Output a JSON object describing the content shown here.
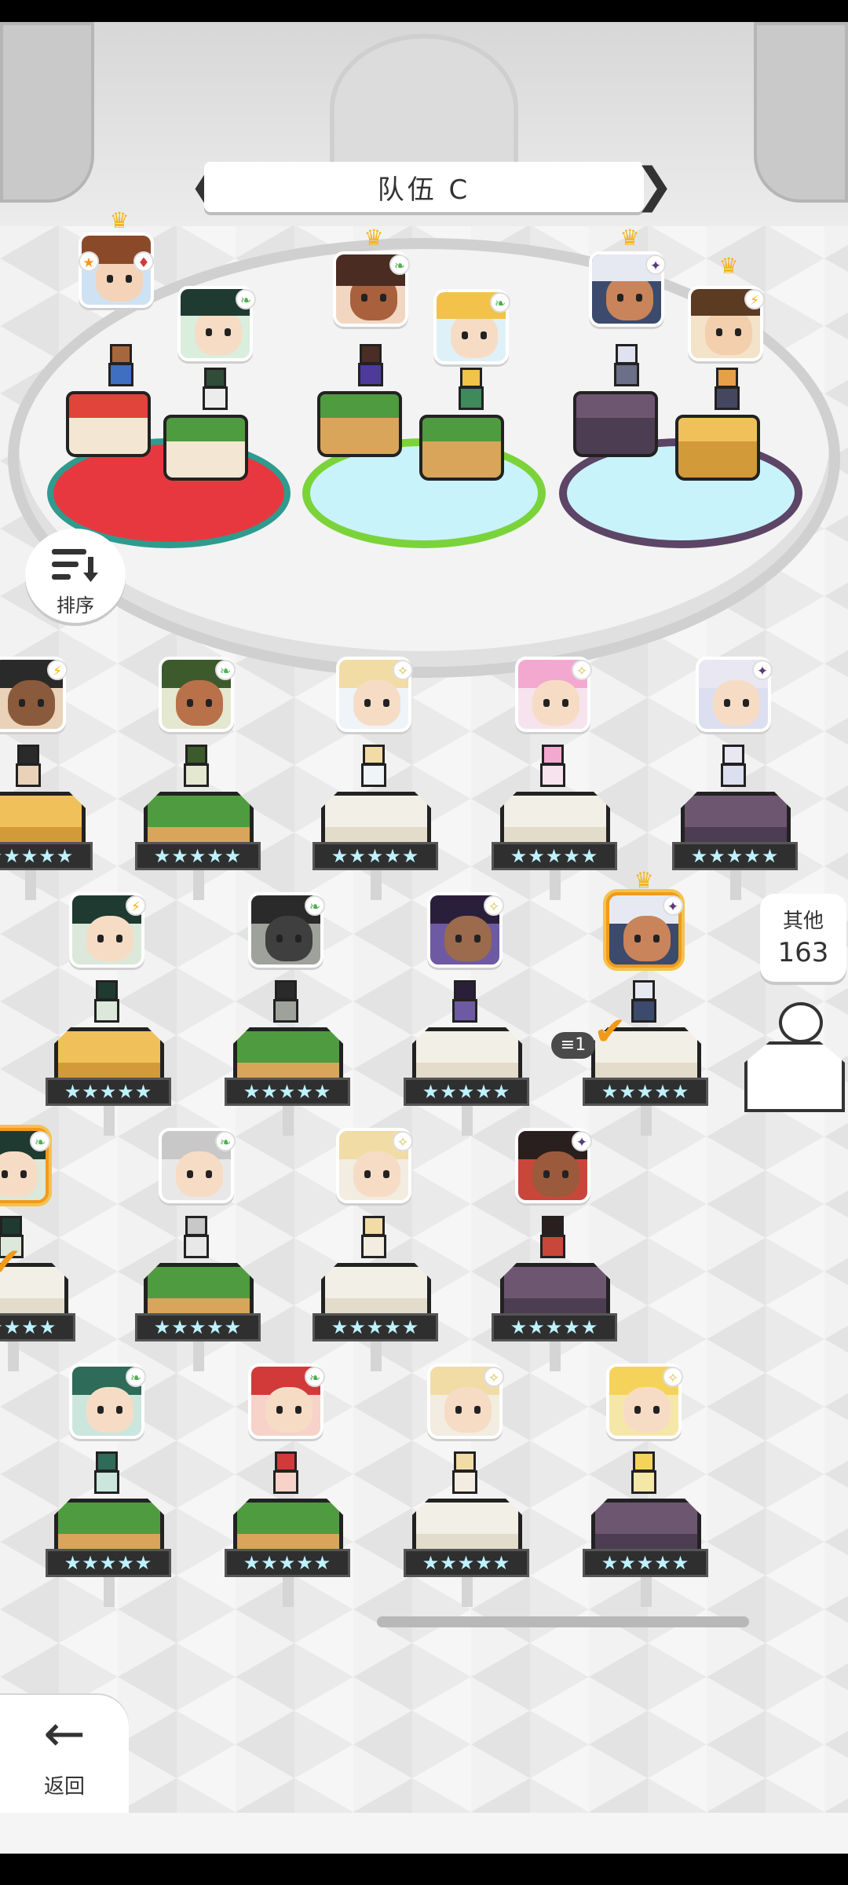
{
  "team": {
    "title": "队伍 C",
    "prev_arrow": "❮",
    "next_arrow": "❯"
  },
  "sort_button": {
    "label": "排序"
  },
  "other_button": {
    "label": "其他",
    "count": "163"
  },
  "back_button": {
    "label": "返回",
    "arrow": "←"
  },
  "slot_badge": {
    "count": "1"
  },
  "element_icons": {
    "fire": "♦",
    "leaf": "❧",
    "electric": "⚡",
    "light": "✧",
    "dark": "✦"
  },
  "stars_text": "★★★★★",
  "colors": {
    "accent_orange": "#f29a1b",
    "crown_gold": "#f5b51b",
    "red_team": "#e8383f",
    "green_team": "#7bd33a",
    "purple_team": "#5c4566"
  }
}
